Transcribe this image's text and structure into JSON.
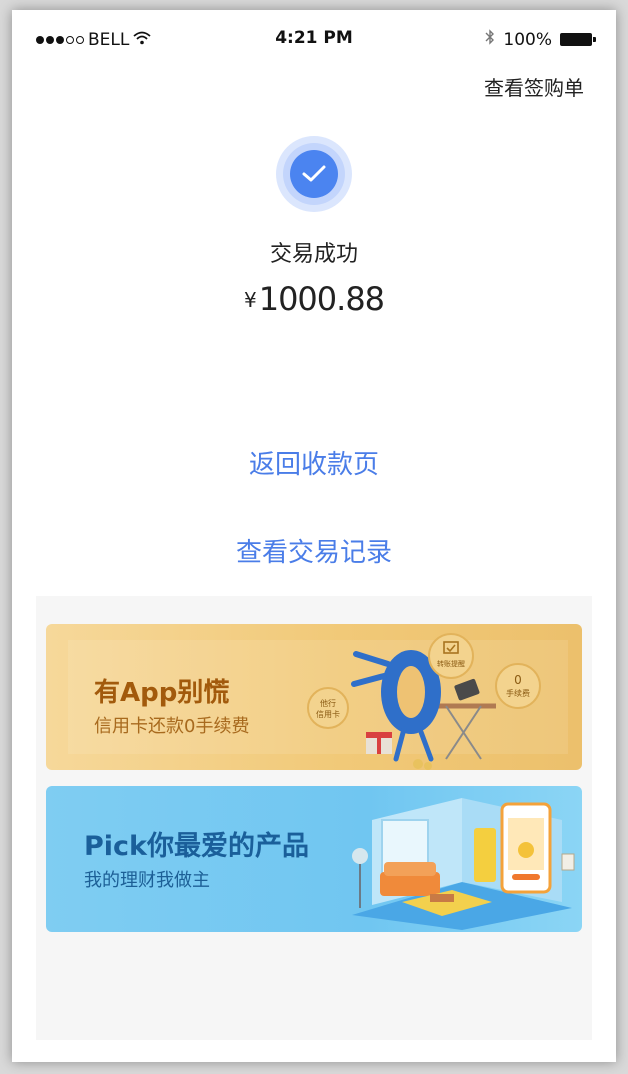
{
  "status_bar": {
    "carrier": "BELL",
    "time": "4:21 PM",
    "battery": "100%"
  },
  "header": {
    "view_order_link": "查看签购单"
  },
  "result": {
    "status": "交易成功",
    "currency_symbol": "¥",
    "amount": "1000.88"
  },
  "actions": {
    "back_label": "返回收款页",
    "records_label": "查看交易记录"
  },
  "banners": [
    {
      "title": "有App别慌",
      "subtitle": "信用卡还款0手续费",
      "badges": [
        "转账提醒",
        "0",
        "手续费",
        "他行",
        "信用卡"
      ]
    },
    {
      "title": "Pick你最爱的产品",
      "subtitle": "我的理财我做主"
    }
  ],
  "colors": {
    "accent": "#4a7de8",
    "success": "#4b84f0",
    "banner1_bg": "#f1c978",
    "banner2_bg": "#70c6f1"
  }
}
